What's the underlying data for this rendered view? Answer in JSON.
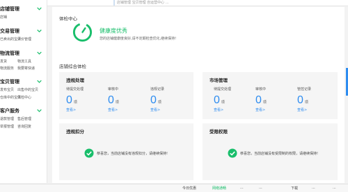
{
  "sidebar": {
    "groups": [
      {
        "title": "店铺管理",
        "subs": [
          [
            "店铺"
          ]
        ]
      },
      {
        "title": "交易管理",
        "subs": [
          [
            "已卖出的宝贝",
            "评价管理"
          ]
        ]
      },
      {
        "title": "物流管理",
        "subs": [
          [
            "发货",
            "物流工具"
          ],
          [
            "物流服务",
            "我要寄快递"
          ]
        ]
      },
      {
        "title": "宝贝管理",
        "subs": [
          [
            "发布宝贝",
            "出售中的宝贝"
          ],
          [
            "仓库中的宝贝",
            "体检中心"
          ]
        ]
      },
      {
        "title": "客户服务",
        "subs": [
          [
            "退款管理",
            "售后管理"
          ],
          [
            "举报管理",
            "咨询回复"
          ]
        ]
      }
    ]
  },
  "top": {
    "text": "店铺管理  宝贝管理  自运营中心  ..."
  },
  "main": {
    "header_title": "体检中心",
    "health": {
      "title": "健康度优秀",
      "desc": "您的店铺健康度良好,请不定期检查优化,继续保持!"
    },
    "overview_title": "店铺综合体检",
    "cards": {
      "violation": {
        "title": "违规处理",
        "stats": [
          {
            "label": "待提交处理",
            "value": "0",
            "unit": "项",
            "link": "查看>"
          },
          {
            "label": "审核中",
            "value": "0",
            "unit": "项",
            "link": "查看>"
          },
          {
            "label": "违规记录",
            "value": "0",
            "unit": "项",
            "link": "查看>"
          }
        ]
      },
      "market": {
        "title": "市场管理",
        "stats": [
          {
            "label": "待提交处理",
            "value": "0",
            "unit": "项",
            "link": "查看>"
          },
          {
            "label": "审核中",
            "value": "0",
            "unit": "项",
            "link": "查看>"
          },
          {
            "label": "管控记录",
            "value": "0",
            "unit": "项",
            "link": "查看>"
          }
        ]
      },
      "deduct": {
        "title": "违规扣分",
        "message": "恭喜您，当前店铺没有违规扣分，请继续保持!"
      },
      "limit": {
        "title": "受限权限",
        "message": "恭喜您，当前店铺没有受限制的权限，请继续保持!"
      }
    }
  },
  "status_bar": {
    "items": [
      "今日优惠",
      "网络通畅",
      "...",
      "...",
      "下载",
      "...",
      "..."
    ]
  },
  "colors": {
    "accent": "#2d8cf0",
    "success": "#19be6b"
  }
}
